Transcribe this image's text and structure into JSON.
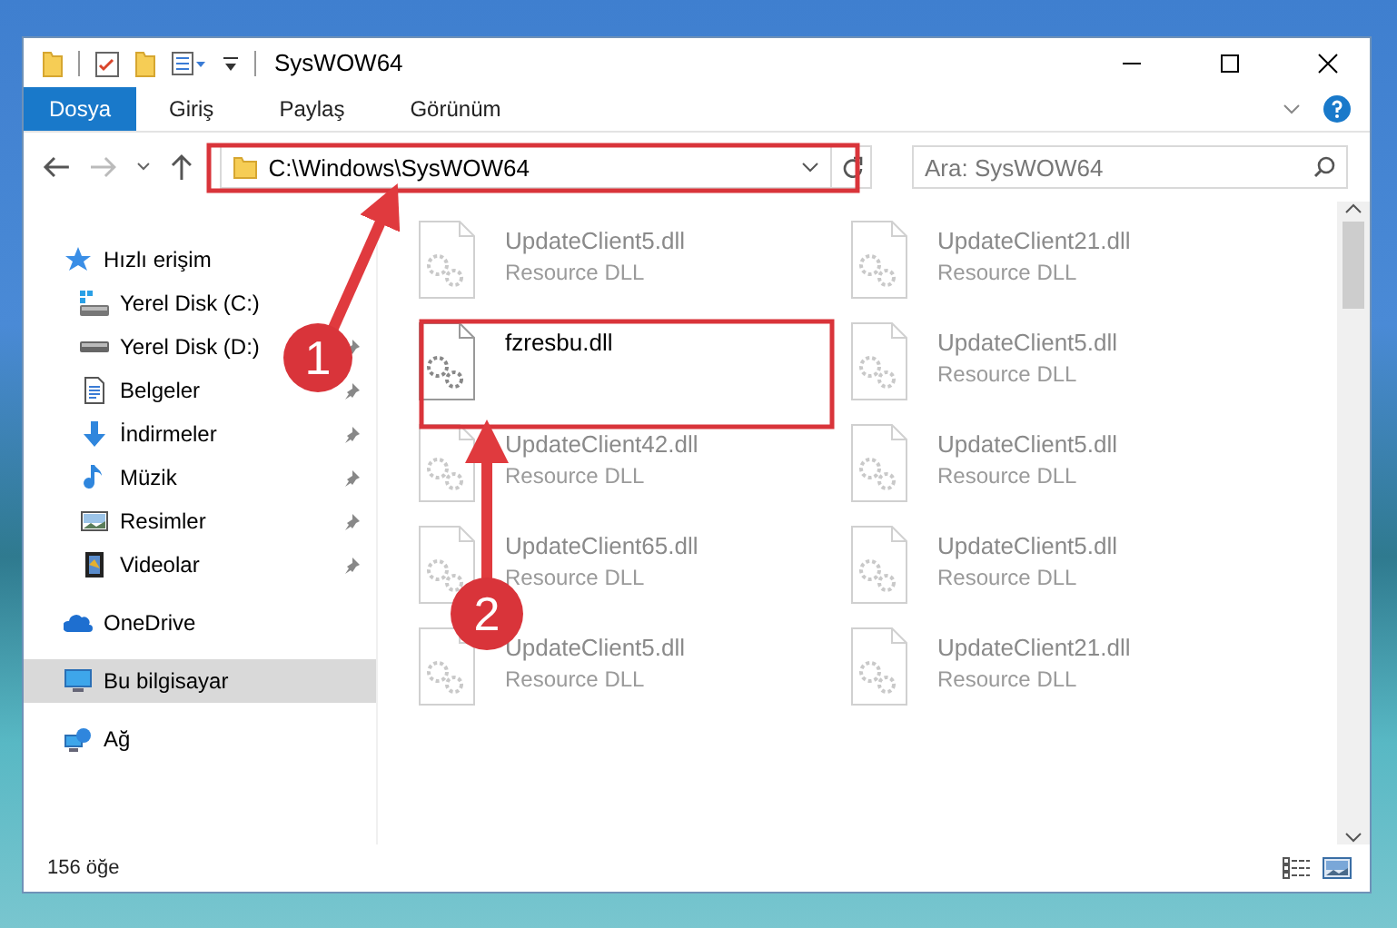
{
  "window": {
    "title": "SysWOW64"
  },
  "ribbon_tabs": [
    {
      "label": "Dosya",
      "selected": true
    },
    {
      "label": "Giriş",
      "selected": false
    },
    {
      "label": "Paylaş",
      "selected": false
    },
    {
      "label": "Görünüm",
      "selected": false
    }
  ],
  "address": {
    "path": "C:\\Windows\\SysWOW64"
  },
  "search": {
    "placeholder": "Ara: SysWOW64"
  },
  "sidebar": {
    "items": [
      {
        "label": "Hızlı erişim",
        "selected": false,
        "children": [
          {
            "label": "Yerel Disk (C:)",
            "pinned": false
          },
          {
            "label": "Yerel Disk (D:)",
            "pinned": true
          },
          {
            "label": "Belgeler",
            "pinned": true
          },
          {
            "label": "İndirmeler",
            "pinned": true
          },
          {
            "label": "Müzik",
            "pinned": true
          },
          {
            "label": "Resimler",
            "pinned": true
          },
          {
            "label": "Videolar",
            "pinned": true
          }
        ]
      },
      {
        "label": "OneDrive",
        "selected": false
      },
      {
        "label": "Bu bilgisayar",
        "selected": true
      },
      {
        "label": "Ağ",
        "selected": false
      }
    ]
  },
  "files": [
    {
      "name": "UpdateClient5.dll",
      "type": "Resource DLL",
      "blurred": true
    },
    {
      "name": "UpdateClient21.dll",
      "type": "Resource DLL",
      "blurred": true
    },
    {
      "name": "fzresbu.dll",
      "blurred": false
    },
    {
      "name": "UpdateClient5.dll",
      "type": "Resource DLL",
      "blurred": true
    },
    {
      "name": "UpdateClient42.dll",
      "type": "Resource DLL",
      "blurred": true
    },
    {
      "name": "UpdateClient5.dll",
      "type": "Resource DLL",
      "blurred": true
    },
    {
      "name": "UpdateClient65.dll",
      "type": "Resource DLL",
      "blurred": true
    },
    {
      "name": "UpdateClient5.dll",
      "type": "Resource DLL",
      "blurred": true
    },
    {
      "name": "UpdateClient5.dll",
      "type": "Resource DLL",
      "blurred": true
    },
    {
      "name": "UpdateClient21.dll",
      "type": "Resource DLL",
      "blurred": true
    }
  ],
  "status_bar": {
    "count": "156 öğe"
  },
  "annotations": [
    {
      "number": "1"
    },
    {
      "number": "2"
    }
  ]
}
